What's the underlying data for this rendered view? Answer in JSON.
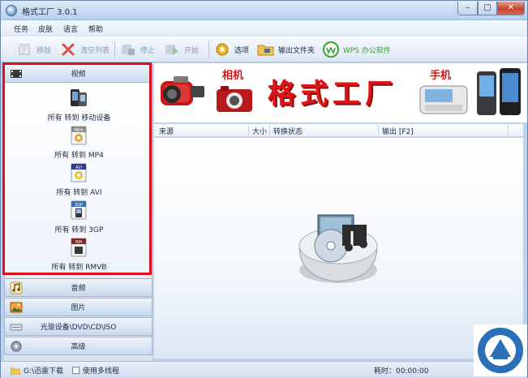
{
  "window": {
    "title": "格式工厂 3.0.1",
    "controls": {
      "minimize": "–",
      "maximize": "□",
      "close": "✕"
    }
  },
  "menu": [
    "任务",
    "皮肤",
    "语言",
    "帮助"
  ],
  "toolbar": {
    "remove": "移除",
    "clear_list": "清空列表",
    "stop": "停止",
    "start": "开始",
    "options": "选项",
    "output_folder": "输出文件夹",
    "wps": "WPS 办公软件"
  },
  "sidebar": {
    "video": {
      "header": "视频",
      "items": [
        {
          "label": "所有 转到 移动设备",
          "icon": "phone-icon"
        },
        {
          "label": "所有 转到 MP4",
          "icon": "mp4-icon"
        },
        {
          "label": "所有 转到 AVI",
          "icon": "avi-icon"
        },
        {
          "label": "所有 转到 3GP",
          "icon": "3gp-icon"
        },
        {
          "label": "所有 转到 RMVB",
          "icon": "rmvb-icon"
        }
      ],
      "scroll_arrow": "▾"
    },
    "categories": [
      "音频",
      "图片",
      "光驱设备\\DVD\\CD\\ISO",
      "高级"
    ],
    "icon_badges": {
      "mp4": "MP4",
      "avi": "AVI",
      "3gp": "3GP",
      "rmvb": "RM"
    }
  },
  "banner": {
    "title": "格式工厂",
    "camera_tag": "相机",
    "phone_tag": "手机"
  },
  "table": {
    "columns": [
      "来源",
      "大小",
      "转换状态",
      "输出 [F2]"
    ]
  },
  "status": {
    "folder": "G:\\迅雷下载",
    "multithread": "使用多线程",
    "elapsed": "耗时：00:00:00"
  },
  "colors": {
    "highlight_border": "#e0101a",
    "banner_red": "#e01515",
    "panel_blue": "#d7e4f4"
  }
}
